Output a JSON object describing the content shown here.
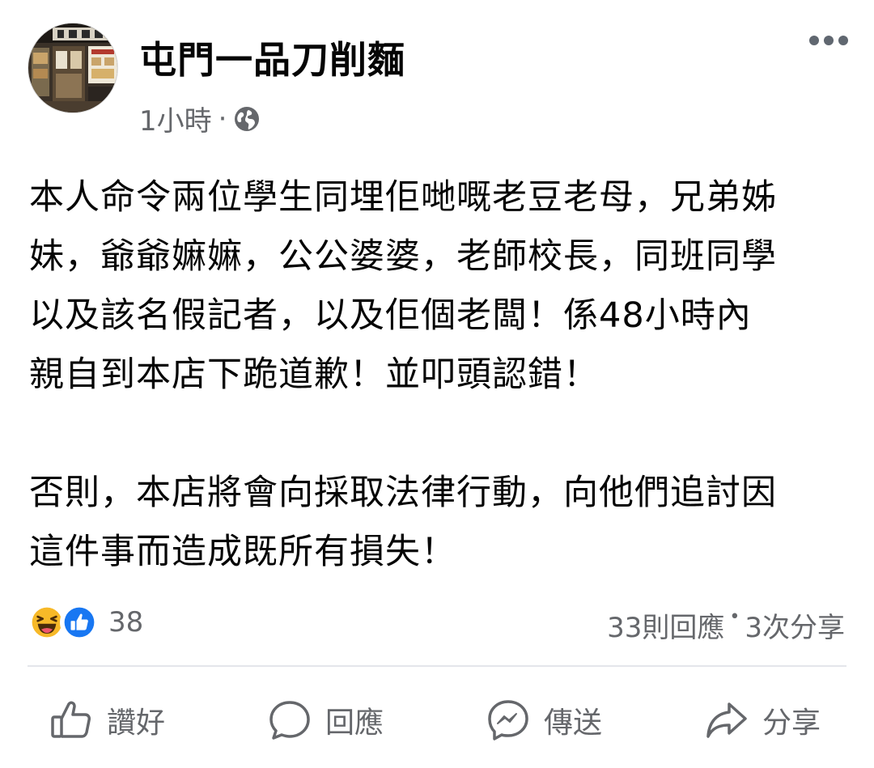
{
  "post": {
    "page_name": "屯門一品刀削麵",
    "timestamp": "1小時",
    "meta_separator": "·",
    "audience_icon": "globe-icon",
    "more_icon": "more-options-icon",
    "paragraphs": [
      [
        "本人命令兩位學生同埋佢哋嘅老豆老母，兄弟姊",
        "妹，爺爺嫲嫲，公公婆婆，老師校長，同班同學",
        "以及該名假記者，以及佢個老闆！係48小時內",
        "親自到本店下跪道歉！並叩頭認錯！"
      ],
      [
        "否則，本店將會向採取法律行動，向他們追討因",
        "這件事而造成既所有損失！"
      ]
    ]
  },
  "engagement": {
    "reaction_icons": [
      "haha-reaction-icon",
      "like-reaction-icon"
    ],
    "reaction_count": "38",
    "comments": "33則回應",
    "separator": "•",
    "shares": "3次分享"
  },
  "actions": {
    "like": "讚好",
    "comment": "回應",
    "send": "傳送",
    "share": "分享"
  },
  "colors": {
    "text_primary": "#050505",
    "text_secondary": "#65676b",
    "like_blue": "#1877f2",
    "haha_yellow": "#f7b928",
    "divider": "#e4e6eb"
  }
}
